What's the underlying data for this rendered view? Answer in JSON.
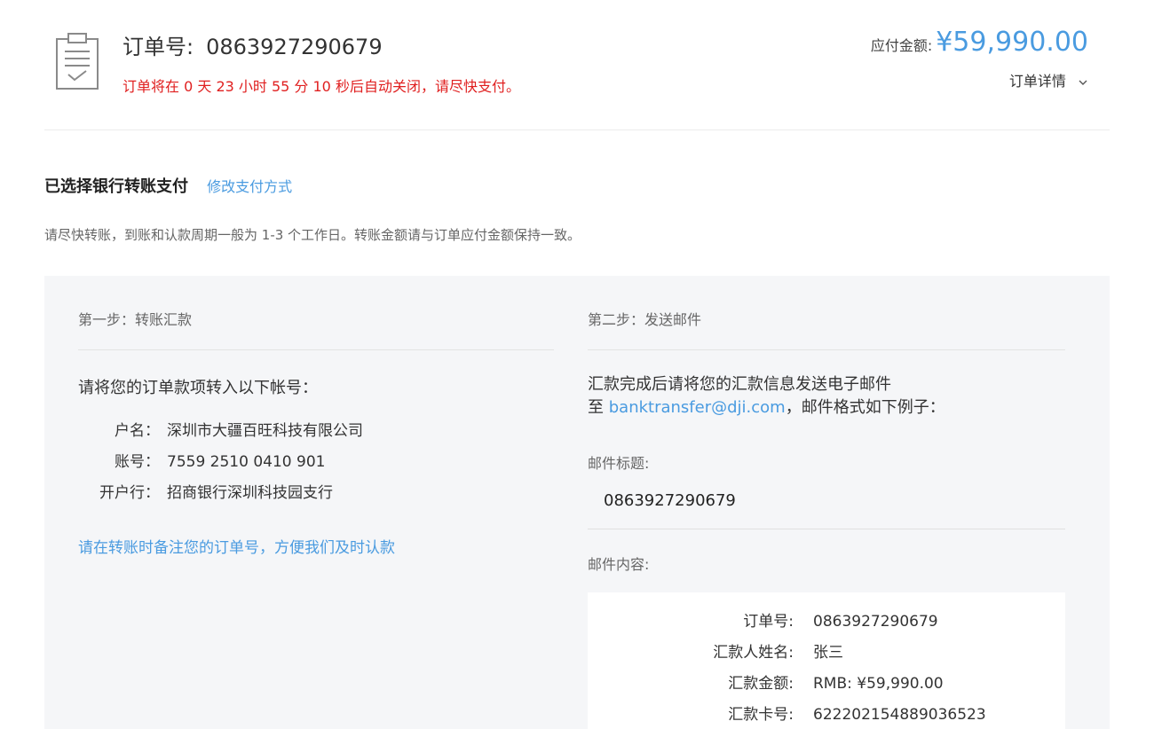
{
  "header": {
    "order_label": "订单号:",
    "order_number": "0863927290679",
    "countdown": "订单将在 0 天 23 小时 55 分 10 秒后自动关闭，请尽快支付。",
    "amount_label": "应付金额:",
    "amount_value": "¥59,990.00",
    "order_detail_label": "订单详情",
    "icons": {
      "order": "clipboard-check-icon",
      "detail": "chevron-down-icon"
    }
  },
  "payment": {
    "selected_title": "已选择银行转账支付",
    "change_link": "修改支付方式",
    "notice": "请尽快转账，到账和认款周期一般为 1-3 个工作日。转账金额请与订单应付金额保持一致。"
  },
  "step1": {
    "title": "第一步：转账汇款",
    "intro": "请将您的订单款项转入以下帐号：",
    "rows": [
      {
        "label": "户名：",
        "value": "深圳市大疆百旺科技有限公司"
      },
      {
        "label": "账号：",
        "value": "7559 2510 0410 901"
      },
      {
        "label": "开户行：",
        "value": "招商银行深圳科技园支行"
      }
    ],
    "tip": "请在转账时备注您的订单号，方便我们及时认款"
  },
  "step2": {
    "title": "第二步：发送邮件",
    "intro_line1": "汇款完成后请将您的汇款信息发送电子邮件",
    "intro_prefix": "至 ",
    "email": "banktransfer@dji.com",
    "intro_suffix": "，邮件格式如下例子：",
    "subject_label": "邮件标题:",
    "subject_value": "0863927290679",
    "content_label": "邮件内容:",
    "content_rows": [
      {
        "label": "订单号:",
        "value": "0863927290679"
      },
      {
        "label": "汇款人姓名:",
        "value": "张三"
      },
      {
        "label": "汇款金额:",
        "value": "RMB: ¥59,990.00"
      },
      {
        "label": "汇款卡号:",
        "value": "622202154889036523"
      }
    ]
  },
  "colors": {
    "accent": "#4a9be0",
    "warning": "#e02020",
    "panel_bg": "#f5f6f8"
  }
}
